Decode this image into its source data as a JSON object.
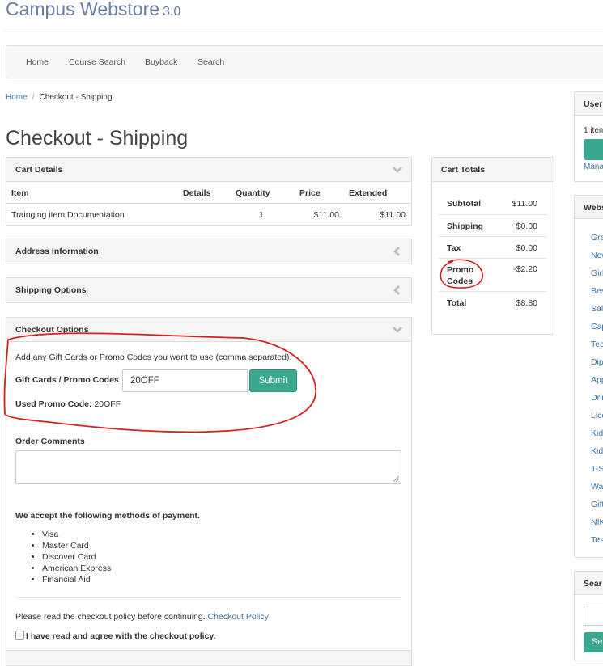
{
  "brand": {
    "name": "Campus Webstore",
    "version": "3.0"
  },
  "nav": {
    "items": [
      "Home",
      "Course Search",
      "Buyback",
      "Search"
    ]
  },
  "breadcrumb": {
    "home": "Home",
    "sep": "/",
    "current": "Checkout - Shipping"
  },
  "page_title": "Checkout - Shipping",
  "cart_details": {
    "title": "Cart Details",
    "headers": {
      "item": "Item",
      "details": "Details",
      "quantity": "Quantity",
      "price": "Price",
      "extended": "Extended"
    },
    "rows": [
      {
        "item": "Trainging item Documentation",
        "details": "",
        "quantity": "1",
        "price": "$11.00",
        "extended": "$11.00"
      }
    ]
  },
  "address_panel": {
    "title": "Address Information"
  },
  "shipping_panel": {
    "title": "Shipping Options"
  },
  "checkout_options": {
    "title": "Checkout Options",
    "promo_hint": "Add any Gift Cards or Promo Codes you want to use (comma separated).",
    "promo_label": "Gift Cards / Promo Codes",
    "promo_value": "20OFF",
    "submit_label": "Submit",
    "used_label": "Used Promo Code:",
    "used_value": "20OFF",
    "comments_label": "Order Comments",
    "payment_title": "We accept the following methods of payment.",
    "payment_methods": [
      "Visa",
      "Master Card",
      "Discover Card",
      "American Express",
      "Financial Aid"
    ],
    "policy_text": "Please read the checkout policy before continuing.",
    "policy_link": "Checkout Policy",
    "agree_label": "I have read and agree with the checkout policy."
  },
  "cart_totals": {
    "title": "Cart Totals",
    "rows": [
      {
        "label": "Subtotal",
        "value": "$11.00"
      },
      {
        "label": "Shipping",
        "value": "$0.00"
      },
      {
        "label": "Tax",
        "value": "$0.00"
      },
      {
        "label": "Promo Codes",
        "value": "-$2.20"
      },
      {
        "label": "Total",
        "value": "$8.80"
      }
    ]
  },
  "sidebar": {
    "user_title": "User",
    "user_items_text": "1 item",
    "user_manage_link": "Mana",
    "webstore_title": "Webs",
    "categories": [
      "Gra",
      "New",
      "Girl",
      "Bes",
      "Sale",
      "Cap",
      "Tec",
      "Dip",
      "App",
      "Drin",
      "Lice",
      "Kid",
      "Kid",
      "T-Sl",
      "Wa",
      "Gift",
      "NIK",
      "Tes"
    ],
    "search_title": "Sear",
    "search_button": "Sea"
  },
  "annotation_color": "#d62020",
  "colors": {
    "accent": "#3aa98f",
    "link": "#3a72a8"
  }
}
